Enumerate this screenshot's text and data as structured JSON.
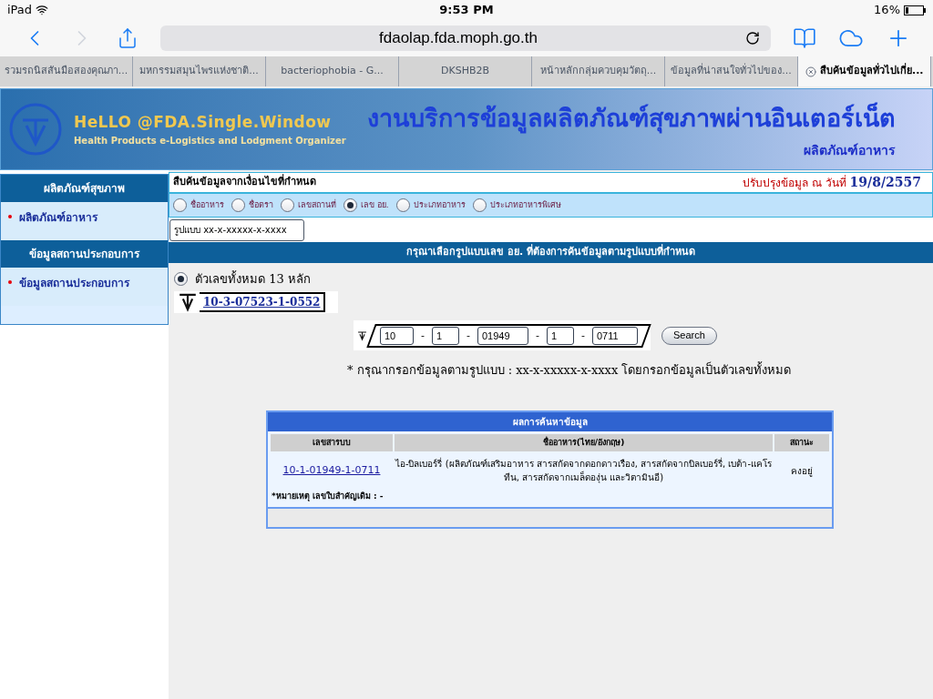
{
  "status_bar": {
    "device": "iPad",
    "time": "9:53 PM",
    "battery": "16%"
  },
  "browser": {
    "url": "fdaolap.fda.moph.go.th",
    "tabs": [
      {
        "label": "รวมรถนิสสันมือสองคุณภา...",
        "selected": false
      },
      {
        "label": "มหกรรมสมุนไพรแห่งชาติ...",
        "selected": false
      },
      {
        "label": "bacteriophobia - G...",
        "selected": false
      },
      {
        "label": "DKSHB2B",
        "selected": false
      },
      {
        "label": "หน้าหลักกลุ่มควบคุมวัตถุ...",
        "selected": false
      },
      {
        "label": "ข้อมูลที่น่าสนใจทั่วไปของ...",
        "selected": false
      },
      {
        "label": "สืบค้นข้อมูลทั่วไปเกี่ย...",
        "selected": true
      }
    ]
  },
  "banner": {
    "logo_title": "HeLLO @FDA.Single.Window",
    "logo_subtitle": "Health Products e-Logistics and Lodgment Organizer",
    "title": "งานบริการข้อมูลผลิตภัณฑ์สุขภาพผ่านอินเตอร์เน็ต",
    "subtitle": "ผลิตภัณฑ์อาหาร"
  },
  "sidebar": [
    {
      "heading": "ผลิตภัณฑ์สุขภาพ",
      "items": [
        "ผลิตภัณฑ์อาหาร"
      ]
    },
    {
      "heading": "ข้อมูลสถานประกอบการ",
      "items": [
        "ข้อมูลสถานประกอบการ"
      ]
    }
  ],
  "search": {
    "title": "สืบค้นข้อมูลจากเงื่อนไขที่กำหนด",
    "updated_label": "ปรับปรุงข้อมูล ณ วันที่",
    "updated_date": "19/8/2557",
    "criteria": [
      {
        "label": "ชื่ออาหาร",
        "selected": false
      },
      {
        "label": "ชื่อตรา",
        "selected": false
      },
      {
        "label": "เลขสถานที่",
        "selected": false
      },
      {
        "label": "เลข อย.",
        "selected": true
      },
      {
        "label": "ประเภทอาหาร",
        "selected": false
      },
      {
        "label": "ประเภทอาหารพิเศษ",
        "selected": false
      }
    ],
    "format_select": "รูปแบบ xx-x-xxxxx-x-xxxx",
    "format_heading": "กรุณาเลือกรูปแบบเลข อย. ที่ต้องการค้นข้อมูลตามรูปแบบที่กำหนด",
    "format_options": [
      {
        "label": "ตัวเลขทั้งหมด 13 หลัก",
        "example": "10-3-07523-1-0552",
        "selected": true
      }
    ],
    "fields": [
      "10",
      "1",
      "01949",
      "1",
      "0711"
    ],
    "separator": "-",
    "button": "Search",
    "note": "* กรุณากรอกข้อมูลตามรูปแบบ : xx-x-xxxxx-x-xxxx โดยกรอกข้อมูลเป็นตัวเลขทั้งหมด"
  },
  "results": {
    "title": "ผลการค้นหาข้อมูล",
    "columns": [
      "เลขสารบบ",
      "ชื่ออาหาร(ไทย/อังกฤษ)",
      "สถานะ"
    ],
    "rows": [
      [
        "10-1-01949-1-0711",
        "ไอ-บิลเบอร์รี่ (ผลิตภัณฑ์เสริมอาหาร สารสกัดจากดอกดาวเรือง, สารสกัดจากบิลเบอร์รี่, เบต้า-แคโรทีน, สารสกัดจากเมล็ดองุ่น และวิตามินอี)",
        "คงอยู่"
      ]
    ],
    "remark": "*หมายเหตุ เลขใบสำคัญเดิม : -"
  }
}
